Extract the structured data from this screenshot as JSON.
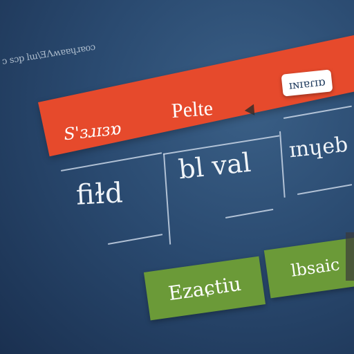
{
  "header": {
    "caption": "ᴐ sɔp lɯ\\ƎɅʍɐɐɥɹɐoɔ",
    "left_label": "S'ɜɹɪɜɒ",
    "title": "Pelte",
    "top_button_label": "ɪɴɪɐɾɪɒ"
  },
  "table": {
    "cells": [
      "fiɫd",
      "bl val",
      "ɪnɥeb"
    ]
  },
  "actions": {
    "primary_label": "Ezaɕtiu",
    "secondary_label": "lbsaic"
  },
  "colors": {
    "background": "#2a4a70",
    "header_bar": "#e64a2c",
    "button_green": "#6b9a38",
    "button_white": "#ffffff",
    "grid_lines": "#c9d6e6"
  },
  "icons": {
    "cursor": "cursor-arrow-icon"
  }
}
